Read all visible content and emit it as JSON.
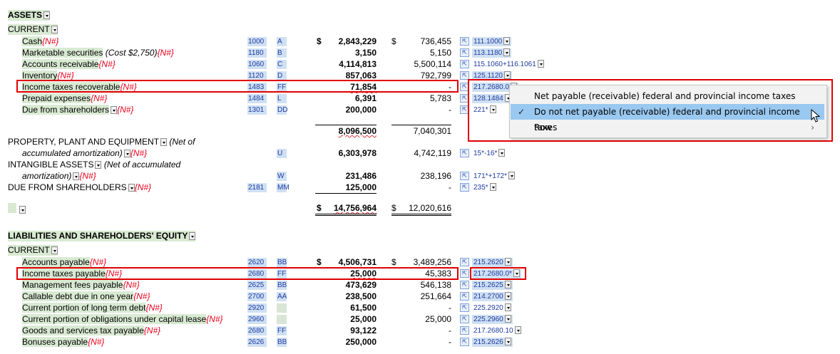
{
  "assets": {
    "heading": "ASSETS",
    "current": "CURRENT",
    "rows": [
      {
        "label": "Cash",
        "flag": "{N#}",
        "acct": "1000",
        "lead": "A",
        "cur": "2,843,229",
        "prior": "736,455",
        "ref": "111.1000",
        "cur_dollar": "$",
        "prior_dollar": "$"
      },
      {
        "label": "Marketable securities",
        "note": "(Cost $2,750)",
        "flag": "{N#}",
        "acct": "1180",
        "lead": "B",
        "cur": "3,150",
        "prior": "5,150",
        "ref": "113.1180"
      },
      {
        "label": "Accounts receivable",
        "flag": "{N#}",
        "acct": "1060",
        "lead": "C",
        "cur": "4,114,813",
        "prior": "5,500,114",
        "ref": "115.1060+116.1061"
      },
      {
        "label": "Inventory",
        "flag": "{N#}",
        "acct": "1120",
        "lead": "D",
        "cur": "857,063",
        "prior": "792,799",
        "ref": "125.1120"
      },
      {
        "label": "Income taxes recoverable",
        "flag": "{N#}",
        "acct": "1483",
        "lead": "FF",
        "cur": "71,854",
        "prior": "-",
        "ref": "217.2680.0"
      },
      {
        "label": "Prepaid expenses",
        "flag": "{N#}",
        "acct": "1484",
        "lead": "L",
        "cur": "6,391",
        "prior": "5,783",
        "ref": "128.1484"
      },
      {
        "label": "Due from shareholders",
        "flag": "{N#}",
        "acct": "1301",
        "lead": "DD",
        "cur": "200,000",
        "prior": "-",
        "ref": "221*"
      }
    ],
    "current_total": {
      "cur": "8,096,500",
      "prior": "7,040,301"
    },
    "ppe_label": "PROPERTY, PLANT AND EQUIPMENT",
    "ppe_note1": "(Net of",
    "ppe_note2": "accumulated amortization)",
    "ppe": {
      "lead": "U",
      "cur": "6,303,978",
      "prior": "4,742,119",
      "ref": "15*-16*"
    },
    "intangible_label": "INTANGIBLE ASSETS",
    "intangible_note1": "(Net of accumulated",
    "intangible_note2": "amortization)",
    "intangible": {
      "lead": "W",
      "cur": "231,486",
      "prior": "238,196",
      "ref": "171*+172*"
    },
    "due_label": "DUE FROM SHAREHOLDERS",
    "due": {
      "acct": "2181",
      "lead": "MM",
      "cur": "125,000",
      "prior": "-",
      "ref": "235*"
    },
    "total": {
      "cur_dollar": "$",
      "cur": "14,756,964",
      "prior_dollar": "$",
      "prior": "12,020,616"
    }
  },
  "liabilities": {
    "heading": "LIABILITIES AND SHAREHOLDERS' EQUITY",
    "current": "CURRENT",
    "rows": [
      {
        "label": "Accounts payable",
        "flag": "{N#}",
        "acct": "2620",
        "lead": "BB",
        "cur": "4,506,731",
        "prior": "3,489,256",
        "ref": "215.2620",
        "cur_dollar": "$",
        "prior_dollar": "$"
      },
      {
        "label": "Income taxes payable",
        "flag": "{N#}",
        "acct": "2680",
        "lead": "FF",
        "cur": "25,000",
        "prior": "45,383",
        "ref": "217.2680.0*"
      },
      {
        "label": "Management fees payable",
        "flag": "{N#}",
        "acct": "2625",
        "lead": "BB",
        "cur": "473,629",
        "prior": "546,138",
        "ref": "215.2625"
      },
      {
        "label": "Callable debt due in one year",
        "flag": "{N#}",
        "acct": "2700",
        "lead": "AA",
        "cur": "238,500",
        "prior": "251,664",
        "ref": "214.2700"
      },
      {
        "label": "Current portion of long term debt",
        "flag": "{N#}",
        "acct": "2920",
        "lead": "",
        "cur": "61,500",
        "prior": "-",
        "ref": "225.2920"
      },
      {
        "label": "Current portion of obligations under capital lease",
        "flag": "{N#}",
        "acct": "2960",
        "lead": "",
        "cur": "25,000",
        "prior": "25,000",
        "ref": "225.2960"
      },
      {
        "label": "Goods and services tax payable",
        "flag": "{N#}",
        "acct": "2680",
        "lead": "FF",
        "cur": "93,122",
        "prior": "-",
        "ref": "217.2680.10"
      },
      {
        "label": "Bonuses payable",
        "flag": "{N#}",
        "acct": "2626",
        "lead": "BB",
        "cur": "250,000",
        "prior": "-",
        "ref": "215.2626"
      }
    ]
  },
  "menu": {
    "items": [
      {
        "label": "Net payable (receivable) federal and provincial income taxes"
      },
      {
        "label": "Do not net payable (receivable) federal and provincial income taxes",
        "checked": true
      },
      {
        "label": "Row"
      }
    ],
    "check_glyph": "✓",
    "submenu_glyph": "›"
  },
  "icons": {
    "link": "⇱"
  }
}
